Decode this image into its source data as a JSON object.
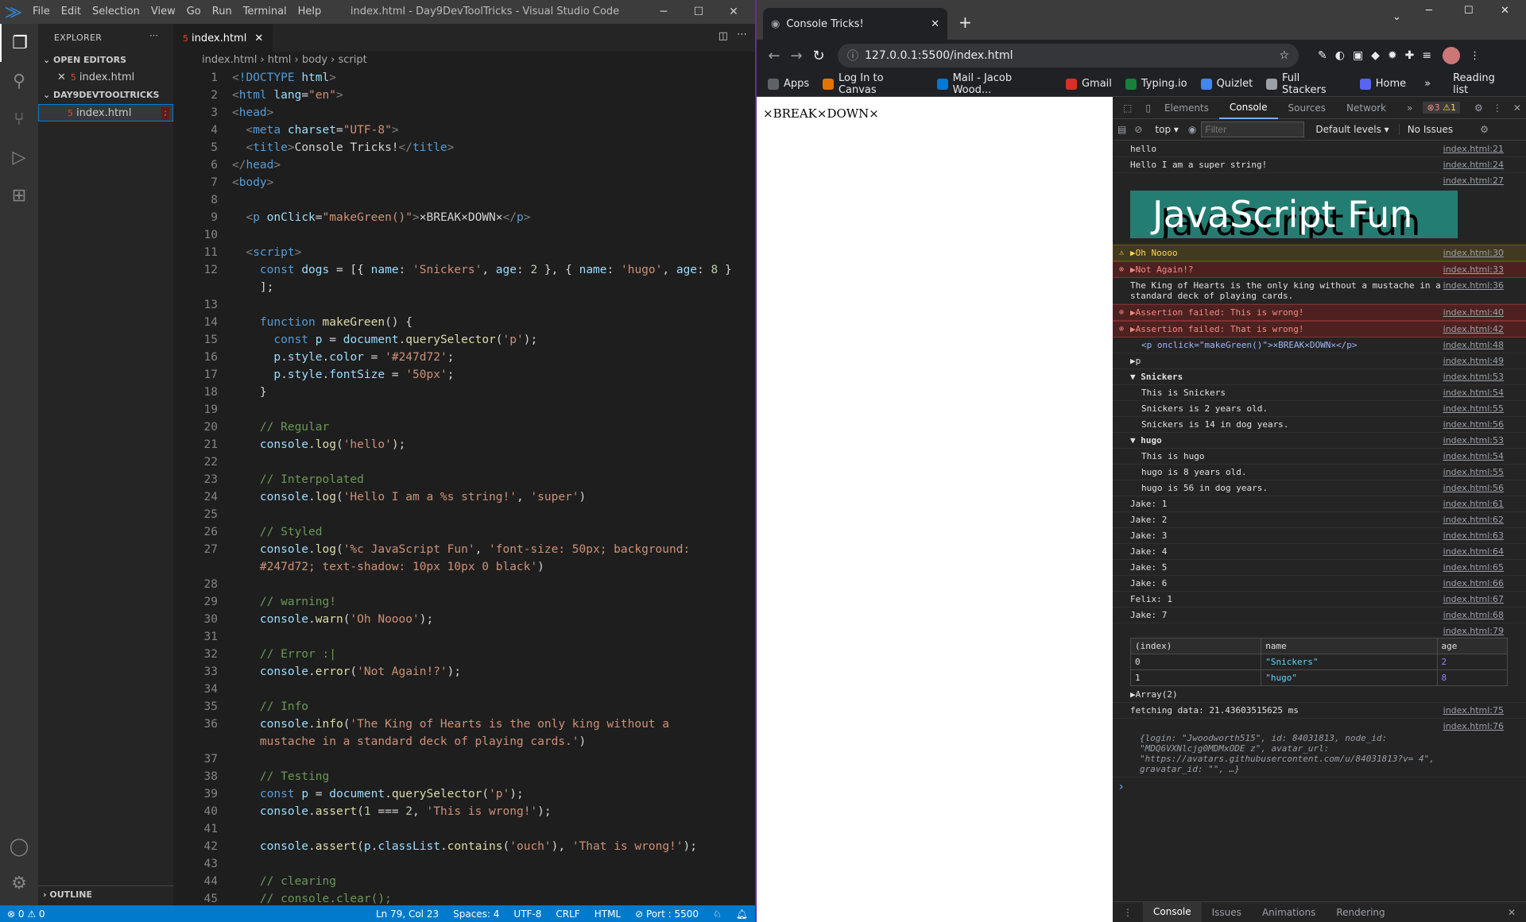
{
  "vscode": {
    "menu": [
      "File",
      "Edit",
      "Selection",
      "View",
      "Go",
      "Run",
      "Terminal",
      "Help"
    ],
    "window_title": "index.html - Day9DevToolTricks - Visual Studio Code",
    "explorer_title": "EXPLORER",
    "open_editors": "OPEN EDITORS",
    "open_file": "index.html",
    "folder": "DAY9DEVTOOLTRICKS",
    "folder_file": "index.html",
    "outline": "OUTLINE",
    "tab": "index.html",
    "breadcrumb": [
      "index.html",
      "html",
      "body",
      "script"
    ],
    "code": [
      {
        "n": "1",
        "h": "<span class='br'>&lt;</span><span class='tag'>!DOCTYPE</span> <span class='at'>html</span><span class='br'>&gt;</span>"
      },
      {
        "n": "2",
        "h": "<span class='br'>&lt;</span><span class='tag'>html</span> <span class='at'>lang</span>=<span class='s'>\"en\"</span><span class='br'>&gt;</span>"
      },
      {
        "n": "3",
        "h": "<span class='br'>&lt;</span><span class='tag'>head</span><span class='br'>&gt;</span>"
      },
      {
        "n": "4",
        "h": "  <span class='br'>&lt;</span><span class='tag'>meta</span> <span class='at'>charset</span>=<span class='s'>\"UTF-8\"</span><span class='br'>&gt;</span>"
      },
      {
        "n": "5",
        "h": "  <span class='br'>&lt;</span><span class='tag'>title</span><span class='br'>&gt;</span>Console Tricks!<span class='br'>&lt;/</span><span class='tag'>title</span><span class='br'>&gt;</span>"
      },
      {
        "n": "6",
        "h": "<span class='br'>&lt;/</span><span class='tag'>head</span><span class='br'>&gt;</span>"
      },
      {
        "n": "7",
        "h": "<span class='br'>&lt;</span><span class='tag'>body</span><span class='br'>&gt;</span>"
      },
      {
        "n": "8",
        "h": ""
      },
      {
        "n": "9",
        "h": "  <span class='br'>&lt;</span><span class='tag'>p</span> <span class='at'>onClick</span>=<span class='s'>\"makeGreen()\"</span><span class='br'>&gt;</span>×BREAK×DOWN×<span class='br'>&lt;/</span><span class='tag'>p</span><span class='br'>&gt;</span>"
      },
      {
        "n": "10",
        "h": ""
      },
      {
        "n": "11",
        "h": "  <span class='br'>&lt;</span><span class='tag'>script</span><span class='br'>&gt;</span>"
      },
      {
        "n": "12",
        "h": "    <span class='k'>const</span> <span class='v'>dogs</span> = [{ <span class='v'>name</span>: <span class='s'>'Snickers'</span>, <span class='v'>age</span>: <span class='n'>2</span> }, { <span class='v'>name</span>: <span class='s'>'hugo'</span>, <span class='v'>age</span>: <span class='n'>8</span> }"
      },
      {
        "n": "",
        "h": "    ];"
      },
      {
        "n": "13",
        "h": ""
      },
      {
        "n": "14",
        "h": "    <span class='k'>function</span> <span class='f'>makeGreen</span>() {"
      },
      {
        "n": "15",
        "h": "      <span class='k'>const</span> <span class='v'>p</span> = <span class='v'>document</span>.<span class='f'>querySelector</span>(<span class='s'>'p'</span>);"
      },
      {
        "n": "16",
        "h": "      <span class='v'>p</span>.<span class='v'>style</span>.<span class='v'>color</span> = <span class='s'>'#247d72'</span>;"
      },
      {
        "n": "17",
        "h": "      <span class='v'>p</span>.<span class='v'>style</span>.<span class='v'>fontSize</span> = <span class='s'>'50px'</span>;"
      },
      {
        "n": "18",
        "h": "    }"
      },
      {
        "n": "19",
        "h": ""
      },
      {
        "n": "20",
        "h": "    <span class='c'>// Regular</span>"
      },
      {
        "n": "21",
        "h": "    <span class='v'>console</span>.<span class='f'>log</span>(<span class='s'>'hello'</span>);"
      },
      {
        "n": "22",
        "h": ""
      },
      {
        "n": "23",
        "h": "    <span class='c'>// Interpolated</span>"
      },
      {
        "n": "24",
        "h": "    <span class='v'>console</span>.<span class='f'>log</span>(<span class='s'>'Hello I am a %s string!'</span>, <span class='s'>'super'</span>)"
      },
      {
        "n": "25",
        "h": ""
      },
      {
        "n": "26",
        "h": "    <span class='c'>// Styled</span>"
      },
      {
        "n": "27",
        "h": "    <span class='v'>console</span>.<span class='f'>log</span>(<span class='s'>'%c JavaScript Fun'</span>, <span class='s'>'font-size: 50px; background:</span>"
      },
      {
        "n": "",
        "h": "    <span class='s'>#247d72; text-shadow: 10px 10px 0 black'</span>)"
      },
      {
        "n": "28",
        "h": ""
      },
      {
        "n": "29",
        "h": "    <span class='c'>// warning!</span>"
      },
      {
        "n": "30",
        "h": "    <span class='v'>console</span>.<span class='f'>warn</span>(<span class='s'>'Oh Noooo'</span>);"
      },
      {
        "n": "31",
        "h": ""
      },
      {
        "n": "32",
        "h": "    <span class='c'>// Error :|</span>"
      },
      {
        "n": "33",
        "h": "    <span class='v'>console</span>.<span class='f'>error</span>(<span class='s'>'Not Again!?'</span>);"
      },
      {
        "n": "34",
        "h": ""
      },
      {
        "n": "35",
        "h": "    <span class='c'>// Info</span>"
      },
      {
        "n": "36",
        "h": "    <span class='v'>console</span>.<span class='f'>info</span>(<span class='s'>'The King of Hearts is the only king without a</span>"
      },
      {
        "n": "",
        "h": "    <span class='s'>mustache in a standard deck of playing cards.'</span>)"
      },
      {
        "n": "37",
        "h": ""
      },
      {
        "n": "38",
        "h": "    <span class='c'>// Testing</span>"
      },
      {
        "n": "39",
        "h": "    <span class='k'>const</span> <span class='v'>p</span> = <span class='v'>document</span>.<span class='f'>querySelector</span>(<span class='s'>'p'</span>);"
      },
      {
        "n": "40",
        "h": "    <span class='v'>console</span>.<span class='f'>assert</span>(<span class='n'>1</span> === <span class='n'>2</span>, <span class='s'>'This is wrong!'</span>);"
      },
      {
        "n": "41",
        "h": ""
      },
      {
        "n": "42",
        "h": "    <span class='v'>console</span>.<span class='f'>assert</span>(<span class='v'>p</span>.<span class='v'>classList</span>.<span class='f'>contains</span>(<span class='s'>'ouch'</span>), <span class='s'>'That is wrong!'</span>);"
      },
      {
        "n": "43",
        "h": ""
      },
      {
        "n": "44",
        "h": "    <span class='c'>// clearing</span>"
      },
      {
        "n": "45",
        "h": "    <span class='c'>// console.clear();</span>"
      }
    ],
    "status": {
      "errors": "0",
      "warnings": "0",
      "position": "Ln 79, Col 23",
      "spaces": "Spaces: 4",
      "encoding": "UTF-8",
      "eol": "CRLF",
      "lang": "HTML",
      "port": "Port : 5500"
    }
  },
  "chrome": {
    "tab_title": "Console Tricks!",
    "url": "127.0.0.1:5500/index.html",
    "bookmarks": [
      "Apps",
      "Log In to Canvas",
      "Mail - Jacob Wood...",
      "Gmail",
      "Typing.io",
      "Quizlet",
      "Full Stackers",
      "Home"
    ],
    "reading_list": "Reading list",
    "page_text": "×BREAK×DOWN×",
    "devtools": {
      "tabs": [
        "Elements",
        "Console",
        "Sources",
        "Network"
      ],
      "err_count": "3",
      "warn_count": "1",
      "context": "top",
      "filter_placeholder": "Filter",
      "levels": "Default levels",
      "issues": "No Issues",
      "console": [
        {
          "text": "hello",
          "src": "index.html:21"
        },
        {
          "text": "Hello I am a super string!",
          "src": "index.html:24"
        },
        {
          "styled": "JavaScript Fun",
          "src": "index.html:27"
        },
        {
          "type": "warn",
          "text": "▶Oh Noooo",
          "src": "index.html:30"
        },
        {
          "type": "err",
          "text": "▶Not Again!?",
          "src": "index.html:33"
        },
        {
          "text": "The King of Hearts is the only king without a mustache in a standard deck of playing cards.",
          "src": "index.html:36"
        },
        {
          "type": "err",
          "text": "▶Assertion failed: This is wrong!",
          "src": "index.html:40"
        },
        {
          "type": "err",
          "text": "▶Assertion failed: That is wrong!",
          "src": "index.html:42"
        },
        {
          "text": "<p onclick=\"makeGreen()\">×BREAK×DOWN×</p>",
          "src": "index.html:48",
          "cls": "ind elem"
        },
        {
          "text": "▶p",
          "src": "index.html:49"
        },
        {
          "text": "▼ Snickers",
          "src": "index.html:53",
          "bold": true
        },
        {
          "text": "This is Snickers",
          "src": "index.html:54",
          "cls": "ind"
        },
        {
          "text": "Snickers is 2 years old.",
          "src": "index.html:55",
          "cls": "ind"
        },
        {
          "text": "Snickers is 14 in dog years.",
          "src": "index.html:56",
          "cls": "ind"
        },
        {
          "text": "▼ hugo",
          "src": "index.html:53",
          "bold": true
        },
        {
          "text": "This is hugo",
          "src": "index.html:54",
          "cls": "ind"
        },
        {
          "text": "hugo is 8 years old.",
          "src": "index.html:55",
          "cls": "ind"
        },
        {
          "text": "hugo is 56 in dog years.",
          "src": "index.html:56",
          "cls": "ind"
        },
        {
          "text": "Jake: 1",
          "src": "index.html:61"
        },
        {
          "text": "Jake: 2",
          "src": "index.html:62"
        },
        {
          "text": "Jake: 3",
          "src": "index.html:63"
        },
        {
          "text": "Jake: 4",
          "src": "index.html:64"
        },
        {
          "text": "Jake: 5",
          "src": "index.html:65"
        },
        {
          "text": "Jake: 6",
          "src": "index.html:66"
        },
        {
          "text": "Felix: 1",
          "src": "index.html:67"
        },
        {
          "text": "Jake: 7",
          "src": "index.html:68"
        },
        {
          "table": true,
          "src": "index.html:79"
        },
        {
          "text": "fetching data: 21.43603515625 ms",
          "src": "index.html:75"
        },
        {
          "obj": true,
          "src": "index.html:76"
        }
      ],
      "table": {
        "headers": [
          "(index)",
          "name",
          "age"
        ],
        "rows": [
          [
            "0",
            "\"Snickers\"",
            "2"
          ],
          [
            "1",
            "\"hugo\"",
            "8"
          ]
        ],
        "footer": "▶Array(2)"
      },
      "obj_text": "{login: \"Jwoodworth515\", id: 84031813, node_id: \"MDQ6VXNlcjg0MDMxODE z\", avatar_url: \"https://avatars.githubusercontent.com/u/84031813?v= 4\", gravatar_id: \"\", …}",
      "drawer": [
        "Console",
        "Issues",
        "Animations",
        "Rendering"
      ]
    }
  }
}
